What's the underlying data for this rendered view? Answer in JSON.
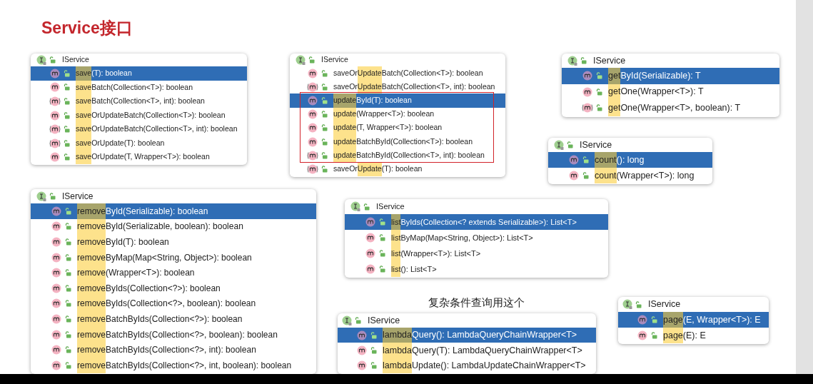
{
  "title": "Service接口",
  "note": "复杂条件查询用这个",
  "popups": [
    {
      "header": "IService",
      "items": [
        {
          "match": "save",
          "rest": "(T): boolean",
          "kind": "method",
          "selected": true
        },
        {
          "match": "save",
          "rest": "Batch(Collection<T>): boolean",
          "kind": "method",
          "selected": false
        },
        {
          "match": "save",
          "rest": "Batch(Collection<T>, int): boolean",
          "kind": "default",
          "selected": false
        },
        {
          "match": "save",
          "rest": "OrUpdateBatch(Collection<T>): boolean",
          "kind": "method",
          "selected": false
        },
        {
          "match": "save",
          "rest": "OrUpdateBatch(Collection<T>, int): boolean",
          "kind": "default",
          "selected": false
        },
        {
          "match": "save",
          "rest": "OrUpdate(T): boolean",
          "kind": "default",
          "selected": false
        },
        {
          "match": "save",
          "rest": "OrUpdate(T, Wrapper<T>): boolean",
          "kind": "method",
          "selected": false
        }
      ]
    },
    {
      "header": "IService",
      "items": [
        {
          "before": "saveOr",
          "match": "Update",
          "rest": "Batch(Collection<T>): boolean",
          "kind": "method",
          "selected": false,
          "boxed": false
        },
        {
          "before": "saveOr",
          "match": "Update",
          "rest": "Batch(Collection<T>, int): boolean",
          "kind": "default",
          "selected": false,
          "boxed": false
        },
        {
          "match": "update",
          "rest": "ById(T): boolean",
          "kind": "method",
          "selected": true,
          "boxed": true
        },
        {
          "match": "update",
          "rest": "(Wrapper<T>): boolean",
          "kind": "method",
          "selected": false,
          "boxed": true
        },
        {
          "match": "update",
          "rest": "(T, Wrapper<T>): boolean",
          "kind": "method",
          "selected": false,
          "boxed": true
        },
        {
          "match": "update",
          "rest": "BatchById(Collection<T>): boolean",
          "kind": "method",
          "selected": false,
          "boxed": true
        },
        {
          "match": "update",
          "rest": "BatchById(Collection<T>, int): boolean",
          "kind": "default",
          "selected": false,
          "boxed": true
        },
        {
          "before": "saveOr",
          "match": "Update",
          "rest": "(T): boolean",
          "kind": "default",
          "selected": false,
          "boxed": false
        }
      ]
    },
    {
      "header": "IService",
      "items": [
        {
          "match": "get",
          "rest": "ById(Serializable): T",
          "kind": "method",
          "selected": true
        },
        {
          "match": "get",
          "rest": "One(Wrapper<T>): T",
          "kind": "method",
          "selected": false
        },
        {
          "match": "get",
          "rest": "One(Wrapper<T>, boolean): T",
          "kind": "default",
          "selected": false
        }
      ]
    },
    {
      "header": "IService",
      "items": [
        {
          "match": "count",
          "rest": "(): long",
          "kind": "method",
          "selected": true
        },
        {
          "match": "count",
          "rest": "(Wrapper<T>): long",
          "kind": "method",
          "selected": false
        }
      ]
    },
    {
      "header": "IService",
      "items": [
        {
          "match": "remove",
          "rest": "ById(Serializable): boolean",
          "kind": "method",
          "selected": true
        },
        {
          "match": "remove",
          "rest": "ById(Serializable, boolean): boolean",
          "kind": "method",
          "selected": false
        },
        {
          "match": "remove",
          "rest": "ById(T): boolean",
          "kind": "method",
          "selected": false
        },
        {
          "match": "remove",
          "rest": "ByMap(Map<String, Object>): boolean",
          "kind": "method",
          "selected": false
        },
        {
          "match": "remove",
          "rest": "(Wrapper<T>): boolean",
          "kind": "method",
          "selected": false
        },
        {
          "match": "remove",
          "rest": "ByIds(Collection<?>): boolean",
          "kind": "method",
          "selected": false
        },
        {
          "match": "remove",
          "rest": "ByIds(Collection<?>, boolean): boolean",
          "kind": "method",
          "selected": false
        },
        {
          "match": "remove",
          "rest": "BatchByIds(Collection<?>): boolean",
          "kind": "method",
          "selected": false
        },
        {
          "match": "remove",
          "rest": "BatchByIds(Collection<?>, boolean): boolean",
          "kind": "method",
          "selected": false
        },
        {
          "match": "remove",
          "rest": "BatchByIds(Collection<?>, int): boolean",
          "kind": "method",
          "selected": false
        },
        {
          "match": "remove",
          "rest": "BatchByIds(Collection<?>, int, boolean): boolean",
          "kind": "method",
          "selected": false
        }
      ]
    },
    {
      "header": "IService",
      "items": [
        {
          "match": "list",
          "rest": "ByIds(Collection<? extends Serializable>): List<T>",
          "kind": "method",
          "selected": true
        },
        {
          "match": "list",
          "rest": "ByMap(Map<String, Object>): List<T>",
          "kind": "method",
          "selected": false
        },
        {
          "match": "list",
          "rest": "(Wrapper<T>): List<T>",
          "kind": "method",
          "selected": false
        },
        {
          "match": "list",
          "rest": "(): List<T>",
          "kind": "method",
          "selected": false
        }
      ]
    },
    {
      "header": "IService",
      "items": [
        {
          "match": "lambda",
          "rest": "Query(): LambdaQueryChainWrapper<T>",
          "kind": "method",
          "selected": true
        },
        {
          "match": "lambda",
          "rest": "Query(T): LambdaQueryChainWrapper<T>",
          "kind": "method",
          "selected": false
        },
        {
          "match": "lambda",
          "rest": "Update(): LambdaUpdateChainWrapper<T>",
          "kind": "method",
          "selected": false
        }
      ]
    },
    {
      "header": "IService",
      "items": [
        {
          "match": "page",
          "rest": "(E, Wrapper<T>): E",
          "kind": "method",
          "selected": true
        },
        {
          "match": "page",
          "rest": "(E): E",
          "kind": "method",
          "selected": false
        }
      ]
    }
  ]
}
